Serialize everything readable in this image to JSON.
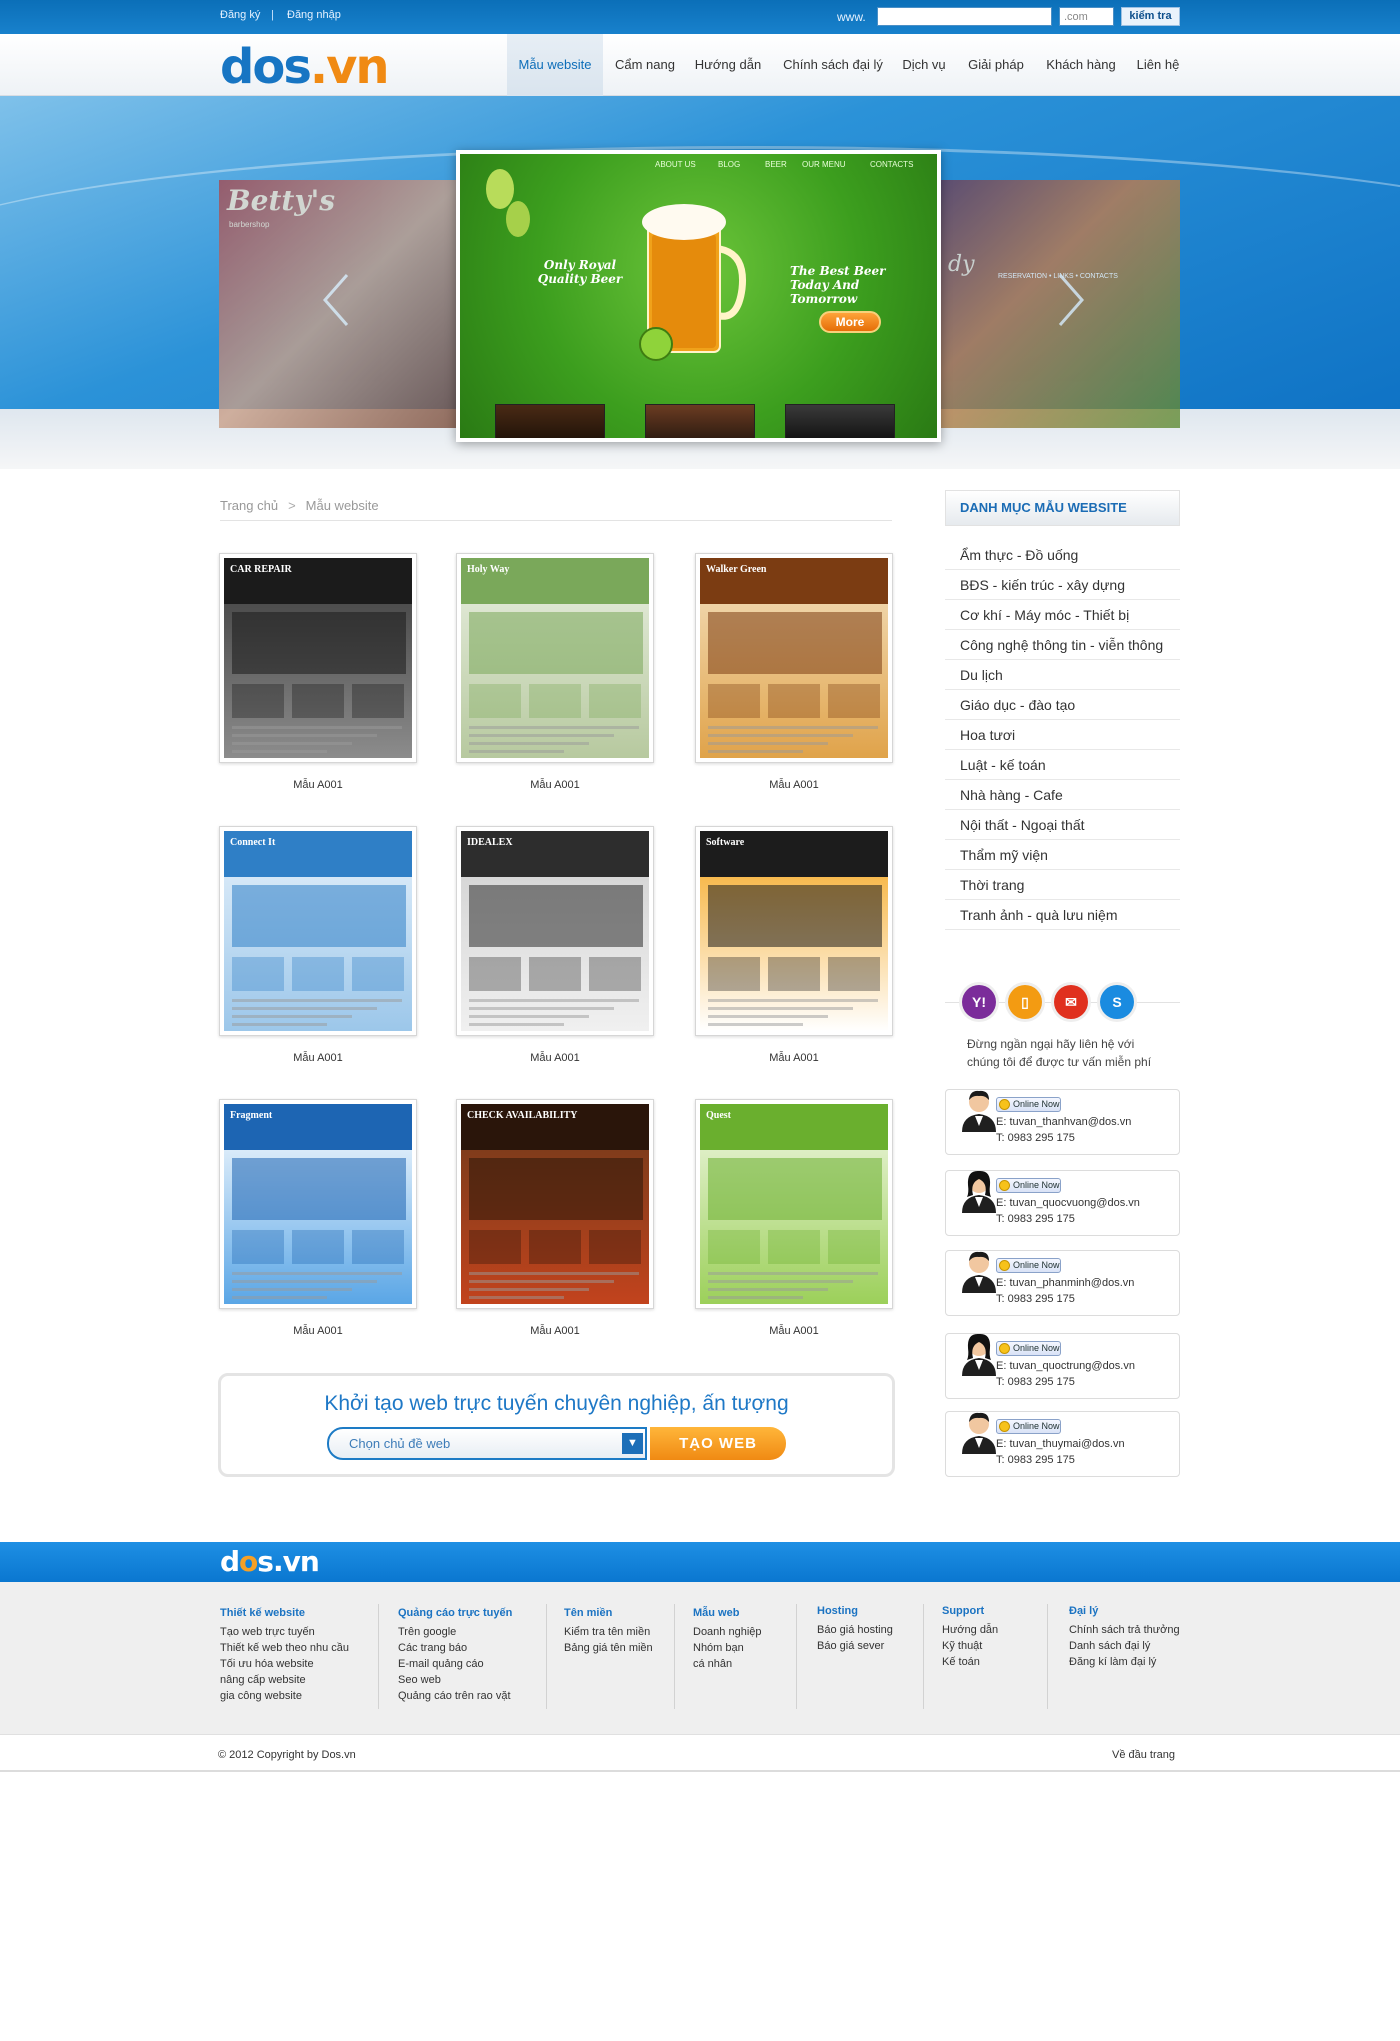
{
  "topbar": {
    "register": "Đăng ký",
    "separator": "|",
    "login": "Đăng nhập",
    "www_label": "www.",
    "domain_value": "",
    "tld_value": ".com",
    "check_label": "kiểm tra"
  },
  "logo": {
    "part1": "dos",
    "part2": ".",
    "part3": "vn"
  },
  "nav": [
    "Mẫu website",
    "Cẩm nang",
    "Hướng dẫn",
    "Chính sách đại lý",
    "Dịch vụ",
    "Giải pháp",
    "Khách hàng",
    "Liên hệ"
  ],
  "banner": {
    "left_brand": "Betty's",
    "left_sub": "barbershop",
    "right_brand": "dy",
    "right_menu": "RESERVATION • LINKS • CONTACTS",
    "main_nav": [
      "ABOUT US",
      "BLOG",
      "BEER",
      "OUR MENU",
      "CONTACTS"
    ],
    "tagline_left": "Only Royal Quality Beer",
    "tagline_right": "The Best Beer Today And Tomorrow",
    "more_label": "More"
  },
  "breadcrumb": {
    "home": "Trang chủ",
    "sep": ">",
    "current": "Mẫu website"
  },
  "templates": [
    {
      "label": "Mẫu A001",
      "header": "CAR REPAIR",
      "colors": [
        "#1b1b1b",
        "#3a3a3a",
        "#8c8c8c"
      ]
    },
    {
      "label": "Mẫu A001",
      "header": "Holy Way",
      "colors": [
        "#7aa85a",
        "#e9efe1",
        "#b7c99f"
      ]
    },
    {
      "label": "Mẫu A001",
      "header": "Walker Green",
      "colors": [
        "#7b3c12",
        "#f4e2c2",
        "#e0a34a"
      ]
    },
    {
      "label": "Mẫu A001",
      "header": "Connect It",
      "colors": [
        "#2f7fc6",
        "#e6f1fb",
        "#9cc7ea"
      ]
    },
    {
      "label": "Mẫu A001",
      "header": "IDEALEX",
      "colors": [
        "#2d2d2d",
        "#cfcfcf",
        "#f0f0f0"
      ]
    },
    {
      "label": "Mẫu A001",
      "header": "Software",
      "colors": [
        "#1c1c1c",
        "#f5a51a",
        "#ffffff"
      ]
    },
    {
      "label": "Mẫu A001",
      "header": "Fragment",
      "colors": [
        "#1d65b3",
        "#ffffff",
        "#5aa6e6"
      ]
    },
    {
      "label": "Mẫu A001",
      "header": "CHECK AVAILABILITY",
      "colors": [
        "#2a150a",
        "#6d3a1a",
        "#c2431d"
      ]
    },
    {
      "label": "Mẫu A001",
      "header": "Quest",
      "colors": [
        "#6aaf2e",
        "#f1f7e4",
        "#9cd05a"
      ]
    }
  ],
  "create": {
    "title": "Khởi tạo web trực tuyến chuyên nghiệp, ấn tượng",
    "select_placeholder": "Chọn chủ đề web",
    "button": "TẠO WEB"
  },
  "sidebar": {
    "title": "DANH MỤC MẪU WEBSITE",
    "categories": [
      "Ẩm thực - Đồ uống",
      "BĐS - kiến trúc - xây dựng",
      "Cơ khí - Máy móc - Thiết bị",
      "Công nghệ thông tin - viễn thông",
      "Du lịch",
      "Giáo dục - đào tạo",
      "Hoa tươi",
      "Luật - kế toán",
      "Nhà hàng - Cafe",
      "Nội thất - Ngoại thất",
      "Thẩm mỹ viện",
      "Thời trang",
      "Tranh ảnh - quà lưu niệm"
    ],
    "support_icons": [
      {
        "name": "yahoo-icon",
        "glyph": "Y!",
        "color": "#7b2c9a"
      },
      {
        "name": "phone-icon",
        "glyph": "▯",
        "color": "#f39b12"
      },
      {
        "name": "mail-icon",
        "glyph": "✉",
        "color": "#e0301e"
      },
      {
        "name": "skype-icon",
        "glyph": "S",
        "color": "#1a8be0"
      }
    ],
    "support_text": "Đừng ngần ngại hãy liên hệ với chúng tôi để được tư vấn miễn phí",
    "online_label": "Online Now",
    "agents": [
      {
        "email": "E: tuvan_thanhvan@dos.vn",
        "tel": "T: 0983 295 175",
        "gender": "m"
      },
      {
        "email": "E: tuvan_quocvuong@dos.vn",
        "tel": "T: 0983 295 175",
        "gender": "f"
      },
      {
        "email": "E: tuvan_phanminh@dos.vn",
        "tel": "T: 0983 295 175",
        "gender": "m"
      },
      {
        "email": "E: tuvan_quoctrung@dos.vn",
        "tel": "T: 0983 295 175",
        "gender": "f"
      },
      {
        "email": "E: tuvan_thuymai@dos.vn",
        "tel": "T: 0983 295 175",
        "gender": "m"
      }
    ]
  },
  "footer": {
    "logo1": "d",
    "logo2": "o",
    "logo3": "s.vn",
    "columns": [
      {
        "title": "Thiết kế website",
        "links": [
          "Tạo web trực tuyến",
          "Thiết kế web theo nhu cầu",
          "Tối ưu hóa website",
          "nâng cấp website",
          "gia công website"
        ]
      },
      {
        "title": "Quảng cáo trực tuyến",
        "links": [
          "Trên google",
          "Các trang báo",
          "E-mail quảng cáo",
          "Seo web",
          "Quảng cáo trên rao vặt"
        ]
      },
      {
        "title": "Tên miền",
        "links": [
          "Kiểm tra tên miền",
          "Bảng giá tên miền"
        ]
      },
      {
        "title": "Mẫu web",
        "links": [
          "Doanh nghiệp",
          "Nhóm bạn",
          "cá nhân"
        ]
      },
      {
        "title": "Hosting",
        "links": [
          "Báo giá hosting",
          "Báo giá sever"
        ]
      },
      {
        "title": "Support",
        "links": [
          "Hướng dẫn",
          "Kỹ thuật",
          "Kế toán"
        ]
      },
      {
        "title": "Đại lý",
        "links": [
          "Chính sách trả thưởng",
          "Danh sách đại lý",
          "Đăng kí làm đại lý"
        ]
      }
    ],
    "copyright": "© 2012 Copyright by Dos.vn",
    "to_top": "Về đầu trang"
  }
}
